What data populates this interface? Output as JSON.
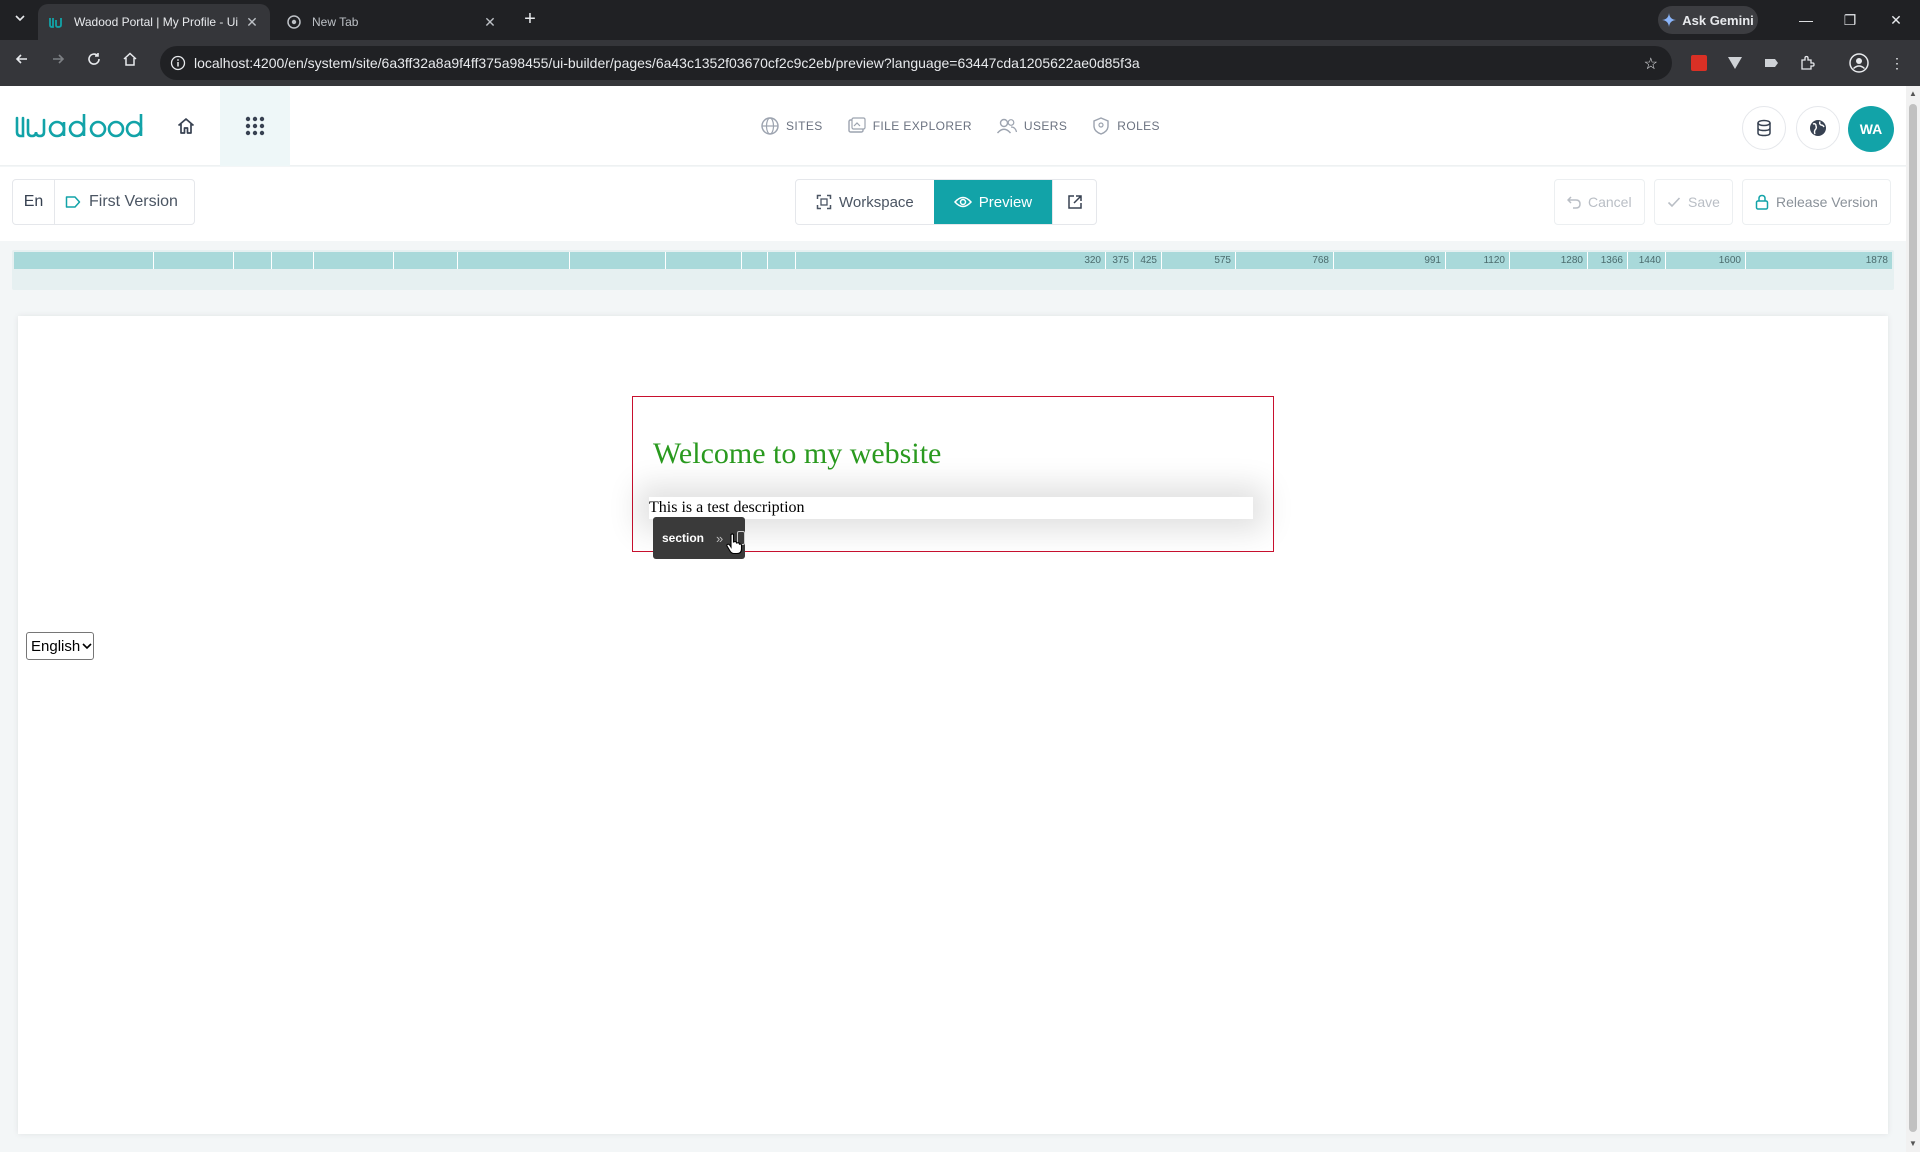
{
  "browser": {
    "tabs": [
      {
        "title": "Wadood Portal | My Profile - Ui",
        "active": true
      },
      {
        "title": "New Tab",
        "active": false
      }
    ],
    "ask_gemini": "Ask Gemini",
    "url": "localhost:4200/en/system/site/6a3ff32a8a9f4ff375a98455/ui-builder/pages/6a43c1352f03670cf2c9c2eb/preview?language=63447cda1205622ae0d85f3a"
  },
  "app": {
    "logo_text": "wadood",
    "brand_color": "#12a3a8",
    "nav": [
      {
        "label": "SITES",
        "icon": "globe-icon"
      },
      {
        "label": "FILE EXPLORER",
        "icon": "folder-icon"
      },
      {
        "label": "USERS",
        "icon": "users-icon"
      },
      {
        "label": "ROLES",
        "icon": "shield-icon"
      }
    ],
    "avatar_initials": "WA"
  },
  "builder": {
    "language_code": "En",
    "version_name": "First Version",
    "modes": {
      "workspace": "Workspace",
      "preview": "Preview"
    },
    "actions": {
      "cancel": "Cancel",
      "save": "Save",
      "release": "Release Version"
    },
    "breakpoints": [
      "320",
      "375",
      "425",
      "575",
      "768",
      "991",
      "1120",
      "1280",
      "1366",
      "1440",
      "1600",
      "1878"
    ]
  },
  "preview": {
    "headline": "Welcome to my website",
    "description": "This is a test description",
    "section_tag": "section",
    "language_select": "English"
  }
}
